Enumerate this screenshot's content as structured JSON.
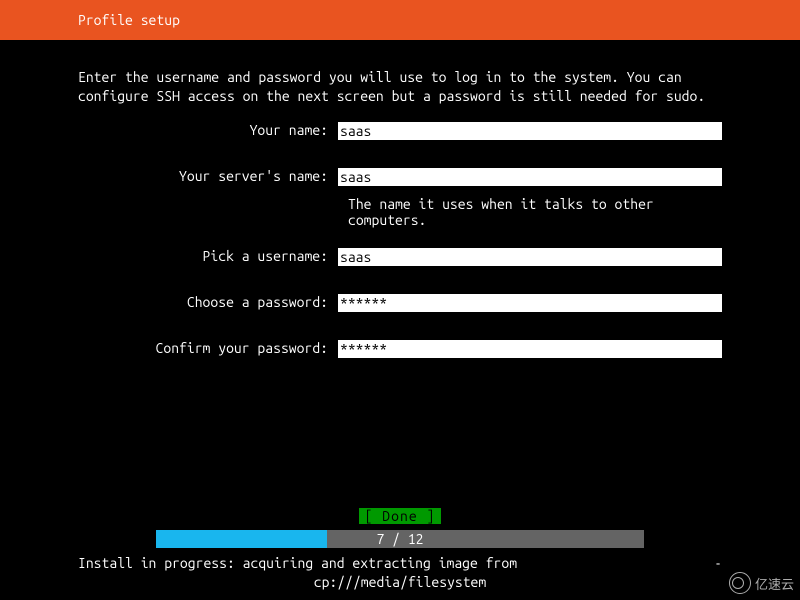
{
  "header": {
    "title": "Profile setup"
  },
  "description": "Enter the username and password you will use to log in to the system. You can configure SSH access on the next screen but a password is still needed for sudo.",
  "form": {
    "name_label": "Your name:",
    "name_value": "saas",
    "server_label": "Your server's name:",
    "server_value": "saas",
    "server_hint": "The name it uses when it talks to other computers.",
    "username_label": "Pick a username:",
    "username_value": "saas",
    "password_label": "Choose a password:",
    "password_value": "******",
    "confirm_label": "Confirm your password:",
    "confirm_value": "******"
  },
  "done_button": "[ Done       ]",
  "progress": {
    "text": "7 / 12",
    "fill_percent": 35
  },
  "status": {
    "line1": "Install in progress: acquiring and extracting image from",
    "spinner": "-",
    "line2": "cp:///media/filesystem"
  },
  "watermark": "亿速云"
}
